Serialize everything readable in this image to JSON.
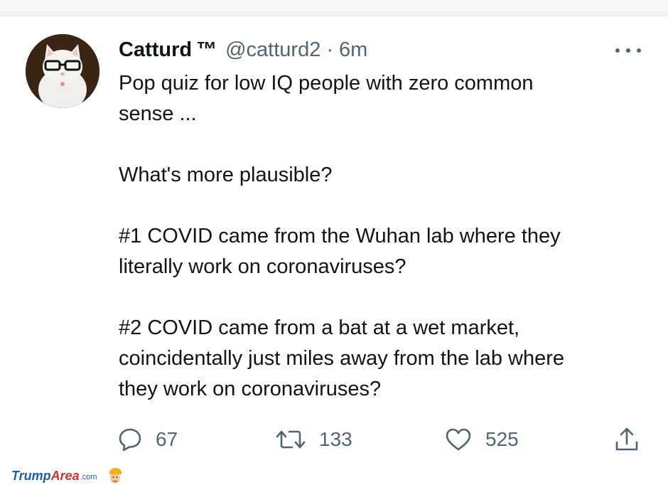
{
  "tweet": {
    "display_name": "Catturd",
    "tm": "™",
    "handle": "@catturd2",
    "separator": "·",
    "time": "6m",
    "lines": [
      "Pop quiz for low IQ people with zero common",
      "sense ...",
      "",
      "What's more plausible?",
      "",
      "#1  COVID came from the Wuhan lab where they",
      "literally work on coronaviruses?",
      "",
      "#2  COVID came from a bat at a wet market,",
      "coincidentally just miles away from the lab where",
      "they work on coronaviruses?"
    ],
    "counts": {
      "replies": "67",
      "retweets": "133",
      "likes": "525"
    }
  },
  "icons": {
    "avatar": "cat-with-glasses-avatar",
    "more": "more-horizontal-icon",
    "reply": "reply-bubble-icon",
    "retweet": "retweet-arrows-icon",
    "like": "heart-icon",
    "share": "share-upload-icon"
  },
  "watermark": {
    "trump": "Trump",
    "area": "Area",
    "com": ".com"
  },
  "colors": {
    "text": "#0f1419",
    "secondary": "#536471",
    "watermark_blue": "#1d5fa8",
    "watermark_red": "#d6312b"
  }
}
